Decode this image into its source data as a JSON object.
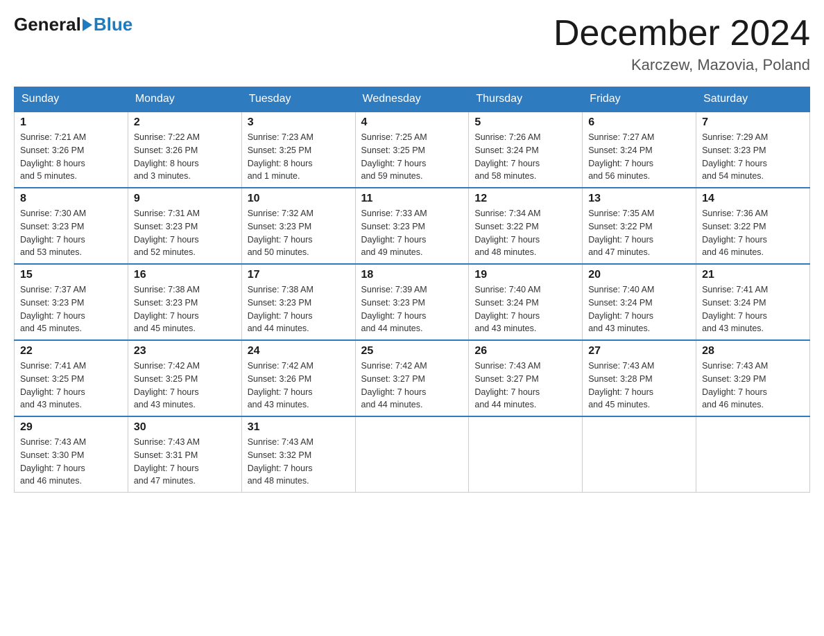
{
  "header": {
    "logo_general": "General",
    "logo_blue": "Blue",
    "month_title": "December 2024",
    "location": "Karczew, Mazovia, Poland"
  },
  "weekdays": [
    "Sunday",
    "Monday",
    "Tuesday",
    "Wednesday",
    "Thursday",
    "Friday",
    "Saturday"
  ],
  "weeks": [
    [
      {
        "day": "1",
        "sunrise": "7:21 AM",
        "sunset": "3:26 PM",
        "daylight": "8 hours and 5 minutes."
      },
      {
        "day": "2",
        "sunrise": "7:22 AM",
        "sunset": "3:26 PM",
        "daylight": "8 hours and 3 minutes."
      },
      {
        "day": "3",
        "sunrise": "7:23 AM",
        "sunset": "3:25 PM",
        "daylight": "8 hours and 1 minute."
      },
      {
        "day": "4",
        "sunrise": "7:25 AM",
        "sunset": "3:25 PM",
        "daylight": "7 hours and 59 minutes."
      },
      {
        "day": "5",
        "sunrise": "7:26 AM",
        "sunset": "3:24 PM",
        "daylight": "7 hours and 58 minutes."
      },
      {
        "day": "6",
        "sunrise": "7:27 AM",
        "sunset": "3:24 PM",
        "daylight": "7 hours and 56 minutes."
      },
      {
        "day": "7",
        "sunrise": "7:29 AM",
        "sunset": "3:23 PM",
        "daylight": "7 hours and 54 minutes."
      }
    ],
    [
      {
        "day": "8",
        "sunrise": "7:30 AM",
        "sunset": "3:23 PM",
        "daylight": "7 hours and 53 minutes."
      },
      {
        "day": "9",
        "sunrise": "7:31 AM",
        "sunset": "3:23 PM",
        "daylight": "7 hours and 52 minutes."
      },
      {
        "day": "10",
        "sunrise": "7:32 AM",
        "sunset": "3:23 PM",
        "daylight": "7 hours and 50 minutes."
      },
      {
        "day": "11",
        "sunrise": "7:33 AM",
        "sunset": "3:23 PM",
        "daylight": "7 hours and 49 minutes."
      },
      {
        "day": "12",
        "sunrise": "7:34 AM",
        "sunset": "3:22 PM",
        "daylight": "7 hours and 48 minutes."
      },
      {
        "day": "13",
        "sunrise": "7:35 AM",
        "sunset": "3:22 PM",
        "daylight": "7 hours and 47 minutes."
      },
      {
        "day": "14",
        "sunrise": "7:36 AM",
        "sunset": "3:22 PM",
        "daylight": "7 hours and 46 minutes."
      }
    ],
    [
      {
        "day": "15",
        "sunrise": "7:37 AM",
        "sunset": "3:23 PM",
        "daylight": "7 hours and 45 minutes."
      },
      {
        "day": "16",
        "sunrise": "7:38 AM",
        "sunset": "3:23 PM",
        "daylight": "7 hours and 45 minutes."
      },
      {
        "day": "17",
        "sunrise": "7:38 AM",
        "sunset": "3:23 PM",
        "daylight": "7 hours and 44 minutes."
      },
      {
        "day": "18",
        "sunrise": "7:39 AM",
        "sunset": "3:23 PM",
        "daylight": "7 hours and 44 minutes."
      },
      {
        "day": "19",
        "sunrise": "7:40 AM",
        "sunset": "3:24 PM",
        "daylight": "7 hours and 43 minutes."
      },
      {
        "day": "20",
        "sunrise": "7:40 AM",
        "sunset": "3:24 PM",
        "daylight": "7 hours and 43 minutes."
      },
      {
        "day": "21",
        "sunrise": "7:41 AM",
        "sunset": "3:24 PM",
        "daylight": "7 hours and 43 minutes."
      }
    ],
    [
      {
        "day": "22",
        "sunrise": "7:41 AM",
        "sunset": "3:25 PM",
        "daylight": "7 hours and 43 minutes."
      },
      {
        "day": "23",
        "sunrise": "7:42 AM",
        "sunset": "3:25 PM",
        "daylight": "7 hours and 43 minutes."
      },
      {
        "day": "24",
        "sunrise": "7:42 AM",
        "sunset": "3:26 PM",
        "daylight": "7 hours and 43 minutes."
      },
      {
        "day": "25",
        "sunrise": "7:42 AM",
        "sunset": "3:27 PM",
        "daylight": "7 hours and 44 minutes."
      },
      {
        "day": "26",
        "sunrise": "7:43 AM",
        "sunset": "3:27 PM",
        "daylight": "7 hours and 44 minutes."
      },
      {
        "day": "27",
        "sunrise": "7:43 AM",
        "sunset": "3:28 PM",
        "daylight": "7 hours and 45 minutes."
      },
      {
        "day": "28",
        "sunrise": "7:43 AM",
        "sunset": "3:29 PM",
        "daylight": "7 hours and 46 minutes."
      }
    ],
    [
      {
        "day": "29",
        "sunrise": "7:43 AM",
        "sunset": "3:30 PM",
        "daylight": "7 hours and 46 minutes."
      },
      {
        "day": "30",
        "sunrise": "7:43 AM",
        "sunset": "3:31 PM",
        "daylight": "7 hours and 47 minutes."
      },
      {
        "day": "31",
        "sunrise": "7:43 AM",
        "sunset": "3:32 PM",
        "daylight": "7 hours and 48 minutes."
      },
      null,
      null,
      null,
      null
    ]
  ],
  "labels": {
    "sunrise": "Sunrise:",
    "sunset": "Sunset:",
    "daylight": "Daylight:"
  }
}
